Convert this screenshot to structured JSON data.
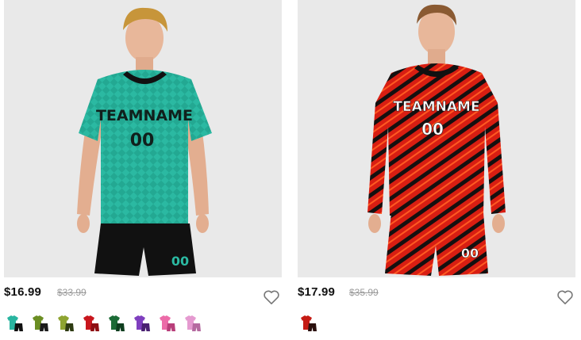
{
  "products": [
    {
      "price": "$16.99",
      "old_price": "$33.99",
      "jersey_text": "TEAMNAME",
      "jersey_number": "00",
      "shorts_number": "00",
      "colors": {
        "shirt": "#2bb9a2",
        "shirt_dark": "#1f9985",
        "collar": "#111111",
        "shorts": "#111111",
        "text": "#10201c",
        "bg": "#e9e9e9"
      },
      "swatches": [
        {
          "name": "teal-black",
          "top": "#29b5a0",
          "bottom": "#111111"
        },
        {
          "name": "green-black",
          "top": "#6b8e23",
          "bottom": "#1b1b1b"
        },
        {
          "name": "olive-green",
          "top": "#8ea431",
          "bottom": "#2e3b12"
        },
        {
          "name": "red-white",
          "top": "#c8161d",
          "bottom": "#8e0e12"
        },
        {
          "name": "forest-green",
          "top": "#1c6b36",
          "bottom": "#0f3e1f"
        },
        {
          "name": "purple",
          "top": "#7f3fbf",
          "bottom": "#4a2172"
        },
        {
          "name": "pink",
          "top": "#ec6ba8",
          "bottom": "#b83e7a"
        },
        {
          "name": "light-pink",
          "top": "#e59ad0",
          "bottom": "#b56aa0"
        }
      ]
    },
    {
      "price": "$17.99",
      "old_price": "$35.99",
      "jersey_text": "TEAMNAME",
      "jersey_number": "00",
      "shorts_number": "00",
      "colors": {
        "shirt": "#d81e12",
        "shirt_dark": "#141010",
        "collar": "#111111",
        "shorts": "#d42414",
        "text": "#ffffff",
        "bg": "#e9e9e9"
      },
      "swatches": [
        {
          "name": "red-black",
          "top": "#c51b14",
          "bottom": "#2a0f0d"
        }
      ]
    }
  ]
}
